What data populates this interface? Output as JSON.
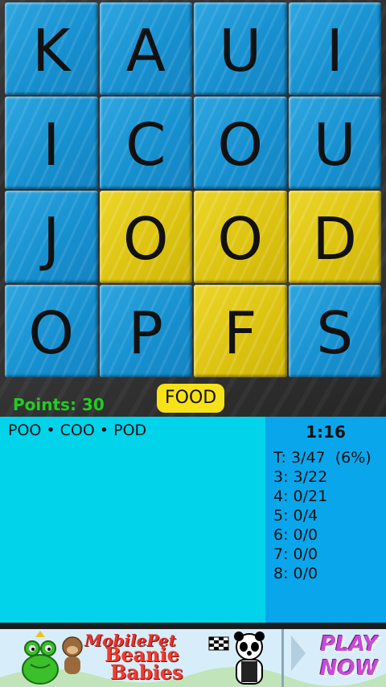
{
  "board": {
    "tiles": [
      {
        "letter": "K",
        "state": "blue"
      },
      {
        "letter": "A",
        "state": "blue"
      },
      {
        "letter": "U",
        "state": "blue"
      },
      {
        "letter": "I",
        "state": "blue"
      },
      {
        "letter": "I",
        "state": "blue"
      },
      {
        "letter": "C",
        "state": "blue"
      },
      {
        "letter": "O",
        "state": "blue"
      },
      {
        "letter": "U",
        "state": "blue"
      },
      {
        "letter": "J",
        "state": "blue"
      },
      {
        "letter": "O",
        "state": "yellow"
      },
      {
        "letter": "O",
        "state": "yellow"
      },
      {
        "letter": "D",
        "state": "yellow"
      },
      {
        "letter": "O",
        "state": "blue"
      },
      {
        "letter": "P",
        "state": "blue"
      },
      {
        "letter": "F",
        "state": "yellow"
      },
      {
        "letter": "S",
        "state": "blue"
      }
    ],
    "colors": {
      "blue": "#1a93d4",
      "yellow": "#e2c814"
    }
  },
  "score": {
    "points_label": "Points: 30"
  },
  "current_word": "FOOD",
  "found_words": "POO • COO • POD",
  "stats": {
    "timer": "1:16",
    "lines": [
      "T: 3/47  (6%)",
      "3: 3/22",
      "4: 0/21",
      "5: 0/4",
      "6: 0/0",
      "7: 0/0",
      "8: 0/0"
    ]
  },
  "ad": {
    "line1": "MobilePet",
    "line2": "Beanie",
    "line3": "Babies",
    "cta_line1": "PLAY",
    "cta_line2": "NOW"
  }
}
